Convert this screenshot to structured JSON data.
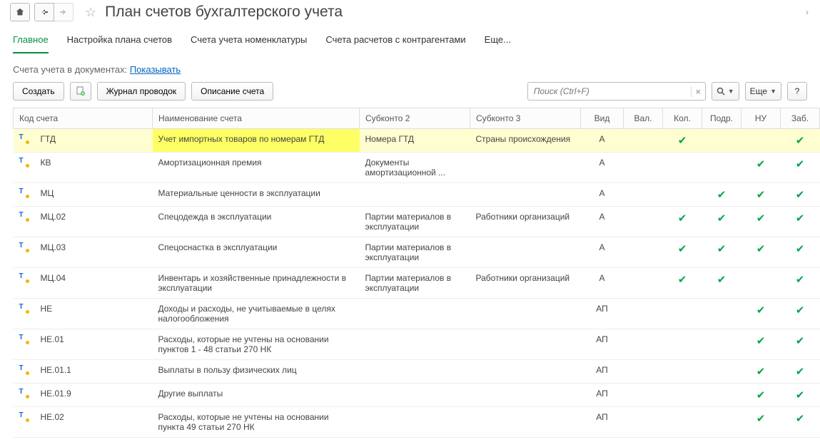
{
  "header": {
    "title": "План счетов бухгалтерского учета"
  },
  "tabs": {
    "items": [
      {
        "label": "Главное",
        "active": true
      },
      {
        "label": "Настройка плана счетов"
      },
      {
        "label": "Счета учета номенклатуры"
      },
      {
        "label": "Счета расчетов с контрагентами"
      },
      {
        "label": "Еще..."
      }
    ]
  },
  "subline": {
    "prefix": "Счета учета в документах: ",
    "link": "Показывать"
  },
  "toolbar": {
    "create": "Создать",
    "journal": "Журнал проводок",
    "descr": "Описание счета",
    "search_placeholder": "Поиск (Ctrl+F)",
    "more": "Еще"
  },
  "columns": {
    "code": "Код счета",
    "name": "Наименование счета",
    "sub2": "Субконто 2",
    "sub3": "Субконто 3",
    "vid": "Вид",
    "val": "Вал.",
    "kol": "Кол.",
    "podr": "Подр.",
    "nu": "НУ",
    "zab": "Заб."
  },
  "rows": [
    {
      "code": "ГТД",
      "name": "Учет импортных товаров по номерам ГТД",
      "sub2": "Номера ГТД",
      "sub3": "Страны происхождения",
      "vid": "А",
      "val": false,
      "kol": true,
      "podr": false,
      "nu": false,
      "zab": true,
      "hl": "strong"
    },
    {
      "code": "КВ",
      "name": "Амортизационная премия",
      "sub2": "Документы амортизационной ...",
      "sub3": "",
      "vid": "А",
      "val": false,
      "kol": false,
      "podr": false,
      "nu": true,
      "zab": true
    },
    {
      "code": "МЦ",
      "name": "Материальные ценности в эксплуатации",
      "sub2": "",
      "sub3": "",
      "vid": "А",
      "val": false,
      "kol": false,
      "podr": true,
      "nu": true,
      "zab": true
    },
    {
      "code": "МЦ.02",
      "name": "Спецодежда в эксплуатации",
      "sub2": "Партии материалов в эксплуатации",
      "sub3": "Работники организаций",
      "vid": "А",
      "val": false,
      "kol": true,
      "podr": true,
      "nu": true,
      "zab": true
    },
    {
      "code": "МЦ.03",
      "name": "Спецоснастка в эксплуатации",
      "sub2": "Партии материалов в эксплуатации",
      "sub3": "",
      "vid": "А",
      "val": false,
      "kol": true,
      "podr": true,
      "nu": true,
      "zab": true
    },
    {
      "code": "МЦ.04",
      "name": "Инвентарь и хозяйственные принадлежности в эксплуатации",
      "sub2": "Партии материалов в эксплуатации",
      "sub3": "Работники организаций",
      "vid": "А",
      "val": false,
      "kol": true,
      "podr": true,
      "nu": false,
      "zab": true
    },
    {
      "code": "НЕ",
      "name": "Доходы и расходы, не учитываемые в целях налогообложения",
      "sub2": "",
      "sub3": "",
      "vid": "АП",
      "val": false,
      "kol": false,
      "podr": false,
      "nu": true,
      "zab": true
    },
    {
      "code": "НЕ.01",
      "name": "Расходы, которые не учтены на основании пунктов 1 - 48 статьи 270 НК",
      "sub2": "",
      "sub3": "",
      "vid": "АП",
      "val": false,
      "kol": false,
      "podr": false,
      "nu": true,
      "zab": true
    },
    {
      "code": "НЕ.01.1",
      "name": "Выплаты в пользу физических лиц",
      "sub2": "",
      "sub3": "",
      "vid": "АП",
      "val": false,
      "kol": false,
      "podr": false,
      "nu": true,
      "zab": true
    },
    {
      "code": "НЕ.01.9",
      "name": "Другие выплаты",
      "sub2": "",
      "sub3": "",
      "vid": "АП",
      "val": false,
      "kol": false,
      "podr": false,
      "nu": true,
      "zab": true
    },
    {
      "code": "НЕ.02",
      "name": "Расходы, которые не учтены на основании пункта 49 статьи 270 НК",
      "sub2": "",
      "sub3": "",
      "vid": "АП",
      "val": false,
      "kol": false,
      "podr": false,
      "nu": true,
      "zab": true
    }
  ]
}
